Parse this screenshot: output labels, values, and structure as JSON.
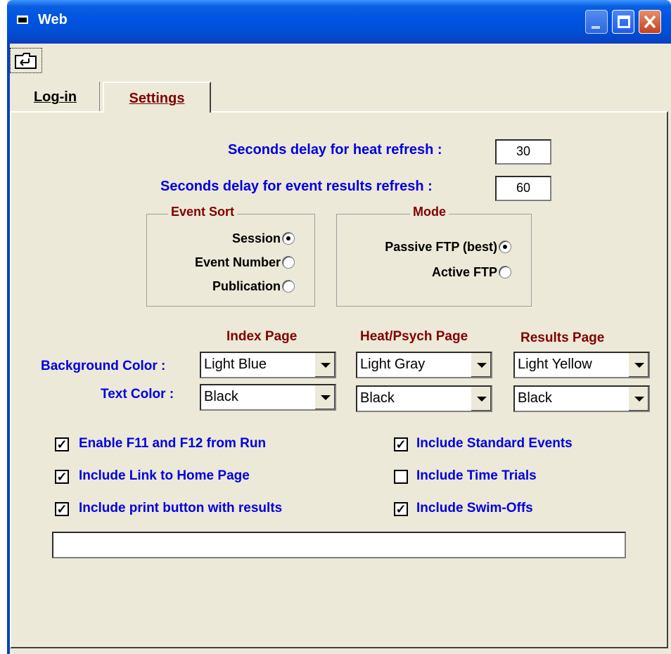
{
  "window": {
    "title": "Web"
  },
  "tabs": [
    {
      "label": "Log-in"
    },
    {
      "label": "Settings"
    }
  ],
  "settings": {
    "heat_refresh_label": "Seconds delay for heat refresh :",
    "heat_refresh_value": "30",
    "event_refresh_label": "Seconds delay for event results refresh :",
    "event_refresh_value": "60",
    "event_sort": {
      "title": "Event Sort",
      "options": [
        {
          "label": "Session",
          "selected": true
        },
        {
          "label": "Event Number",
          "selected": false
        },
        {
          "label": "Publication",
          "selected": false
        }
      ]
    },
    "mode": {
      "title": "Mode",
      "options": [
        {
          "label": "Passive FTP (best)",
          "selected": true
        },
        {
          "label": "Active FTP",
          "selected": false
        }
      ]
    },
    "columns": [
      "Index Page",
      "Heat/Psych Page",
      "Results Page"
    ],
    "background_color_label": "Background Color :",
    "text_color_label": "Text Color :",
    "background_colors": [
      "Light Blue",
      "Light Gray",
      "Light Yellow"
    ],
    "text_colors": [
      "Black",
      "Black",
      "Black"
    ],
    "checkboxes": [
      {
        "label": "Enable F11 and F12 from Run",
        "checked": true
      },
      {
        "label": "Include Link to Home Page",
        "checked": true
      },
      {
        "label": "Include print button with results",
        "checked": true
      },
      {
        "label": "Include Standard Events",
        "checked": true
      },
      {
        "label": "Include Time Trials",
        "checked": false
      },
      {
        "label": "Include Swim-Offs",
        "checked": true
      }
    ],
    "status_text": ""
  },
  "icons": {
    "window_icon": "window-icon",
    "toolbar": "folder-up-icon",
    "minimize": "minimize-icon",
    "maximize": "maximize-icon",
    "close": "close-icon"
  },
  "colors": {
    "title_blue": "#0054e3",
    "label_blue": "#0000e0",
    "label_red": "#800000",
    "face": "#ece9d8"
  }
}
